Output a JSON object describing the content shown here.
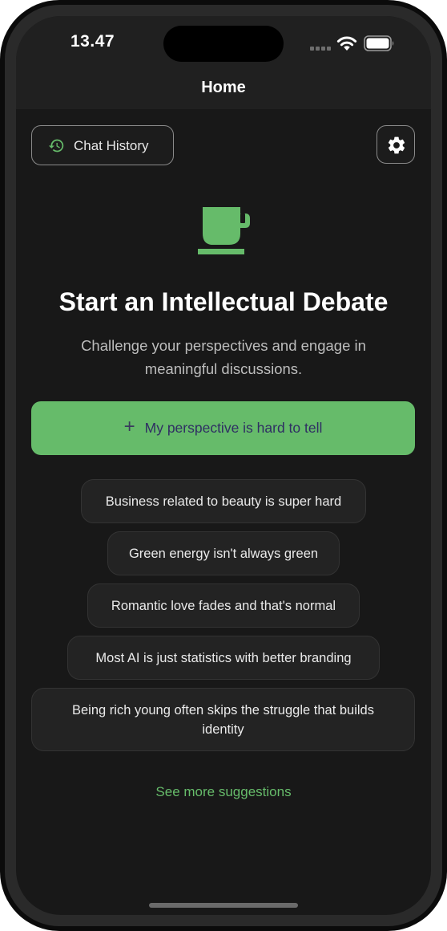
{
  "status_bar": {
    "time": "13.47"
  },
  "nav": {
    "title": "Home"
  },
  "toolbar": {
    "chat_history_label": "Chat History"
  },
  "hero": {
    "title": "Start an Intellectual Debate",
    "subtitle": "Challenge your perspectives and engage in meaningful discussions."
  },
  "primary_action": {
    "label": "My perspective is hard to tell",
    "icon": "plus"
  },
  "suggestions": [
    "Business related to beauty is super hard",
    "Green energy isn't always green",
    "Romantic love fades and that's normal",
    "Most AI is just statistics with better branding",
    "Being rich young often skips the struggle that builds identity"
  ],
  "see_more_label": "See more suggestions",
  "colors": {
    "accent": "#66bb6a",
    "background": "#181818",
    "header": "#202020",
    "card": "#232323"
  },
  "icons": {
    "history": "history-icon",
    "settings": "gear-icon",
    "hero": "coffee-cup-icon",
    "wifi": "wifi-icon",
    "battery": "battery-icon",
    "signal": "signal-icon"
  }
}
